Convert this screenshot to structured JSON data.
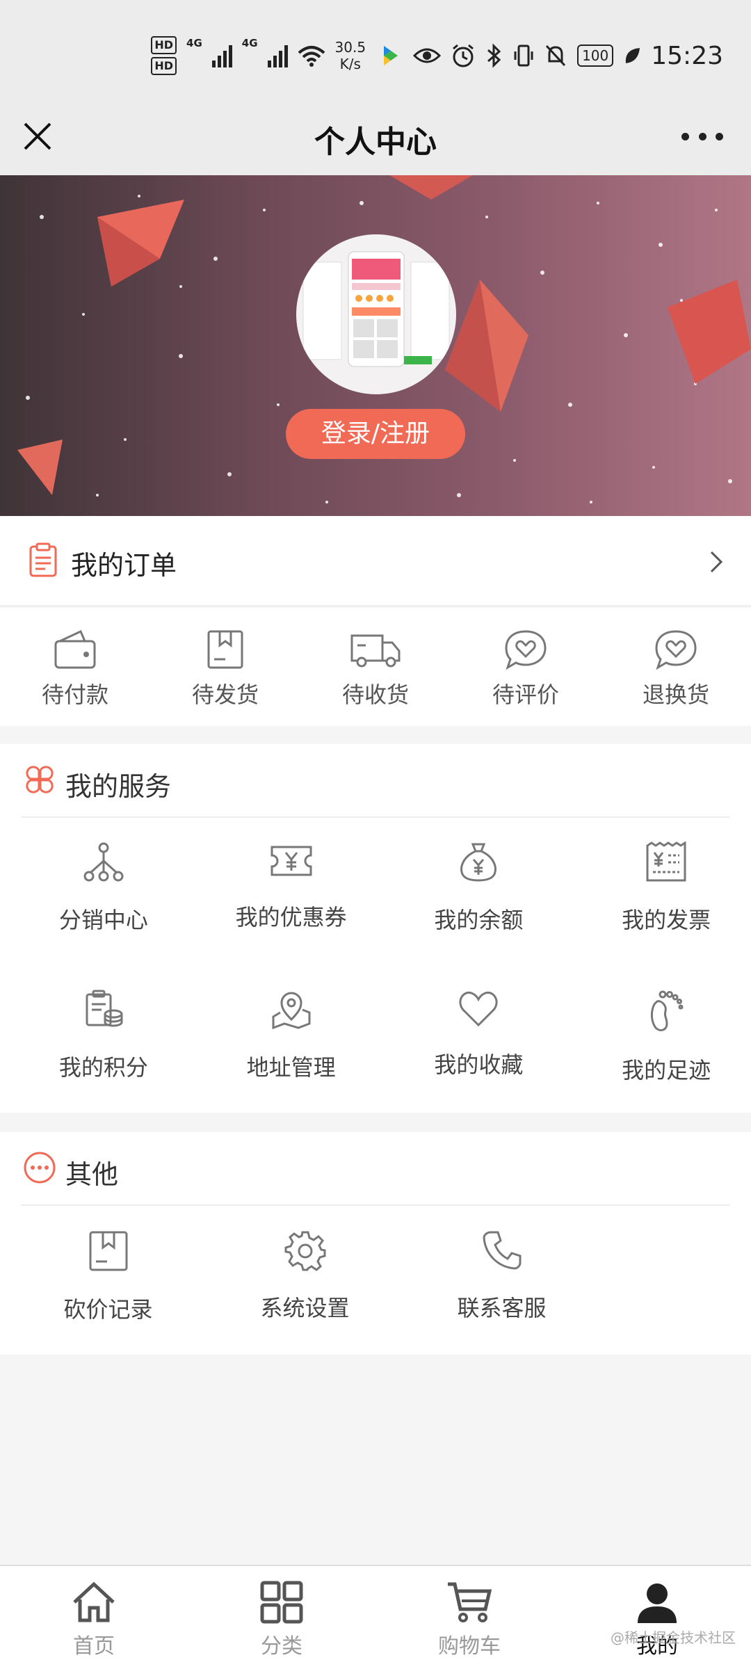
{
  "status_bar": {
    "hd1": "HD",
    "hd2": "HD",
    "net1": "4G",
    "net2": "4G",
    "speed": "30.5",
    "speed_unit": "K/s",
    "battery": "100",
    "time": "15:23"
  },
  "nav": {
    "title": "个人中心"
  },
  "banner": {
    "login_label": "登录/注册"
  },
  "orders": {
    "title": "我的订单",
    "items": [
      {
        "label": "待付款",
        "icon": "wallet-icon"
      },
      {
        "label": "待发货",
        "icon": "box-icon"
      },
      {
        "label": "待收货",
        "icon": "truck-icon"
      },
      {
        "label": "待评价",
        "icon": "heart-chat-icon"
      },
      {
        "label": "退换货",
        "icon": "heart-chat-icon"
      }
    ]
  },
  "services": {
    "title": "我的服务",
    "items": [
      {
        "label": "分销中心",
        "icon": "network-icon"
      },
      {
        "label": "我的优惠券",
        "icon": "coupon-icon"
      },
      {
        "label": "我的余额",
        "icon": "money-bag-icon"
      },
      {
        "label": "我的发票",
        "icon": "invoice-icon"
      },
      {
        "label": "我的积分",
        "icon": "points-icon"
      },
      {
        "label": "地址管理",
        "icon": "location-icon"
      },
      {
        "label": "我的收藏",
        "icon": "heart-icon"
      },
      {
        "label": "我的足迹",
        "icon": "footprint-icon"
      }
    ]
  },
  "other": {
    "title": "其他",
    "items": [
      {
        "label": "砍价记录",
        "icon": "bookmark-box-icon"
      },
      {
        "label": "系统设置",
        "icon": "gear-icon"
      },
      {
        "label": "联系客服",
        "icon": "phone-icon"
      }
    ]
  },
  "tabbar": {
    "items": [
      {
        "label": "首页",
        "icon": "home-icon"
      },
      {
        "label": "分类",
        "icon": "grid-icon"
      },
      {
        "label": "购物车",
        "icon": "cart-icon"
      },
      {
        "label": "我的",
        "icon": "user-icon"
      }
    ],
    "active_index": 3
  },
  "watermark": "@稀土掘金技术社区",
  "colors": {
    "accent": "#f06a55",
    "icon_gray": "#777777"
  }
}
